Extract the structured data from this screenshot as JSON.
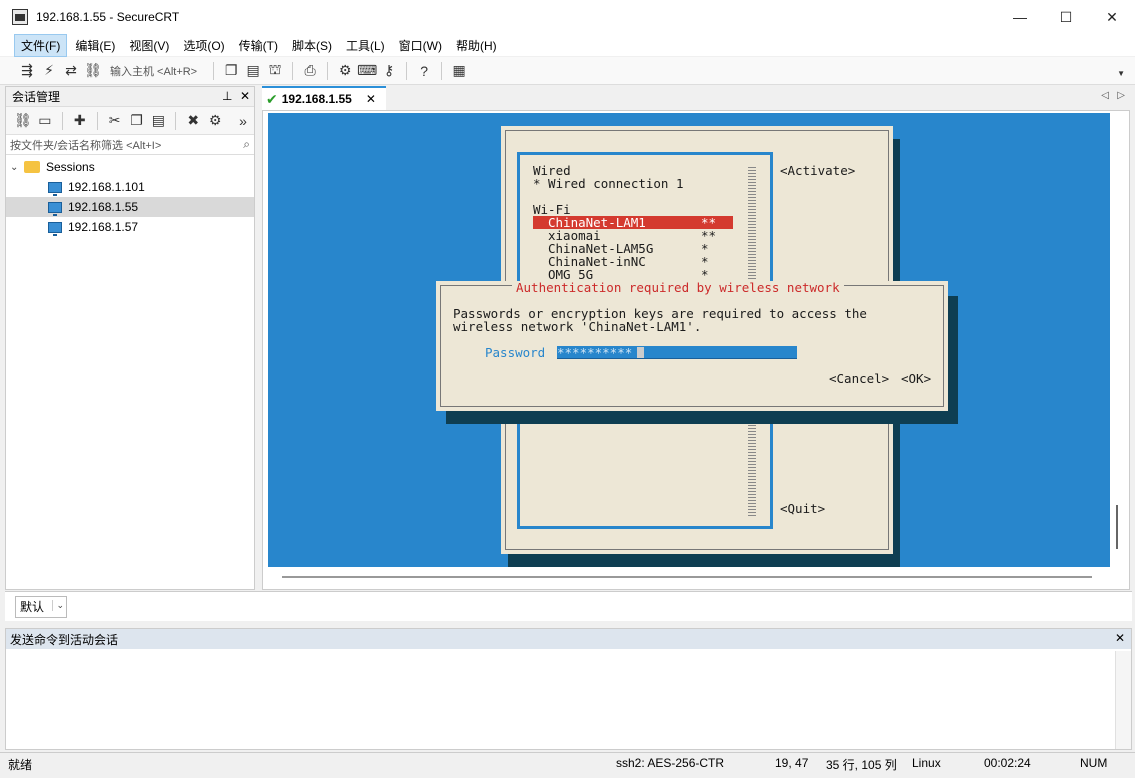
{
  "window": {
    "title": "192.168.1.55 - SecureCRT",
    "minimize": "—",
    "maximize": "☐",
    "close": "✕"
  },
  "menu": [
    "文件(F)",
    "编辑(E)",
    "视图(V)",
    "选项(O)",
    "传输(T)",
    "脚本(S)",
    "工具(L)",
    "窗口(W)",
    "帮助(H)"
  ],
  "toolbar": {
    "host_input_placeholder": "输入主机 <Alt+R>"
  },
  "session_manager": {
    "title": "会话管理",
    "filter_placeholder": "按文件夹/会话名称筛选 <Alt+I>",
    "root": "Sessions",
    "sessions": [
      "192.168.1.101",
      "192.168.1.55",
      "192.168.1.57"
    ],
    "selected_index": 1
  },
  "tabs": [
    {
      "label": "192.168.1.55",
      "connected": true
    }
  ],
  "terminal": {
    "wired_header": "Wired",
    "wired_conn": "* Wired connection 1",
    "wifi_header": "Wi-Fi",
    "networks": [
      {
        "name": "ChinaNet-LAM1",
        "signal": "**"
      },
      {
        "name": "xiaomai",
        "signal": "**"
      },
      {
        "name": "ChinaNet-LAM5G",
        "signal": "*"
      },
      {
        "name": "ChinaNet-inNC",
        "signal": "*"
      },
      {
        "name": "OMG_5G",
        "signal": "*"
      }
    ],
    "activate": "<Activate>",
    "quit": "<Quit>",
    "dialog": {
      "title": "Authentication required by wireless network",
      "line1": "Passwords or encryption keys are required to access the",
      "line2": "wireless network 'ChinaNet-LAM1'.",
      "password_label": "Password",
      "password_value": "**********",
      "cancel": "<Cancel>",
      "ok": "<OK>"
    }
  },
  "command_bar": {
    "selected": "默认"
  },
  "send_panel": {
    "title": "发送命令到活动会话"
  },
  "status": {
    "state": "就绪",
    "cipher": "ssh2: AES-256-CTR",
    "cursor": "19,  47",
    "size": "35 行, 105 列",
    "os": "Linux",
    "time": "00:02:24",
    "num": "NUM"
  }
}
